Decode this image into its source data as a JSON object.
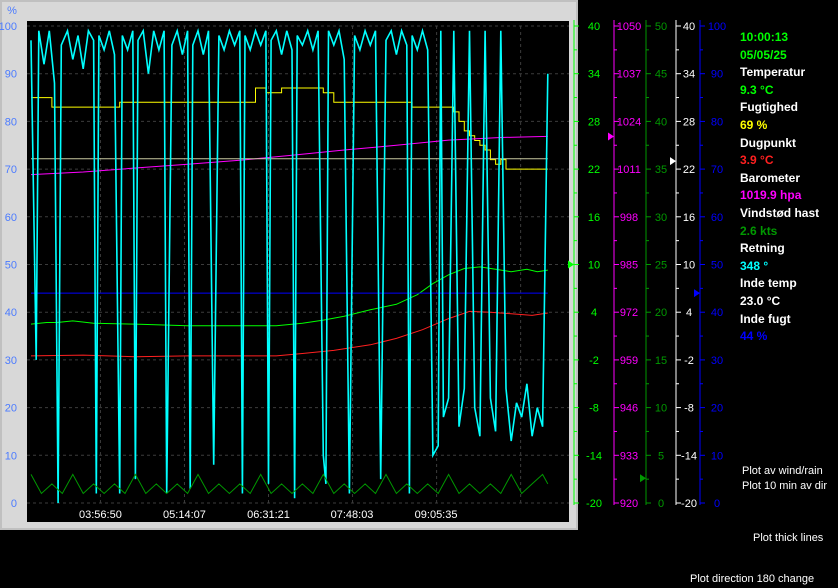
{
  "readout": {
    "time": "10:00:13",
    "date": "05/05/25",
    "items": [
      {
        "label": "Temperatur",
        "value": "9.3 °C",
        "color": "#00ff00"
      },
      {
        "label": "Fugtighed",
        "value": "69 %",
        "color": "#ffff00"
      },
      {
        "label": "Dugpunkt",
        "value": "3.9 °C",
        "color": "#ff2020"
      },
      {
        "label": "Barometer",
        "value": "1019.9 hpa",
        "color": "#ff00ff"
      },
      {
        "label": "Vindstød hast",
        "value": "2.6 kts",
        "color": "#009900"
      },
      {
        "label": "Retning",
        "value": "348 °",
        "color": "#00ffff"
      },
      {
        "label": "Inde temp",
        "value": "23.0 °C",
        "color": "#ffffff"
      },
      {
        "label": "Inde fugt",
        "value": "44 %",
        "color": "#0000ff"
      }
    ]
  },
  "options": {
    "plot_av": "Plot av wind/rain",
    "plot_10min": "Plot 10 min av dir",
    "thick_lines": "Plot thick lines",
    "direction_change": "Plot direction 180 change"
  },
  "chart_data": {
    "type": "line",
    "grid": true,
    "plot_background": "#000000",
    "frame_color": "#c0c0c0",
    "x_tick_labels": [
      "03:56:50",
      "05:14:07",
      "06:31:21",
      "07:48:03",
      "09:05:35"
    ],
    "x_tick_fractions": [
      0.133,
      0.294,
      0.455,
      0.615,
      0.776
    ],
    "y_left_unit": "%",
    "y_left_ticks": [
      "100",
      "90",
      "80",
      "70",
      "60",
      "50",
      "40",
      "30",
      "20",
      "10",
      "0"
    ],
    "y_left_range": [
      0,
      100
    ],
    "right_axes": [
      {
        "name": "Temperatur",
        "color": "#00ff00",
        "range": [
          -20,
          40
        ],
        "ticks": [
          "40",
          "34",
          "28",
          "22",
          "16",
          "10",
          "4",
          "-2",
          "-8",
          "-14",
          "-20"
        ],
        "marker_value": 10
      },
      {
        "name": "Barometer",
        "color": "#ff00ff",
        "range": [
          920,
          1050
        ],
        "ticks": [
          "1050",
          "1037",
          "1024",
          "1011",
          "998",
          "985",
          "972",
          "959",
          "946",
          "933",
          "920"
        ],
        "marker_value": 1019.9
      },
      {
        "name": "Vindstød hast",
        "color": "#009900",
        "range": [
          0,
          50
        ],
        "ticks": [
          "50",
          "45",
          "40",
          "35",
          "30",
          "25",
          "20",
          "15",
          "10",
          "5",
          "0"
        ],
        "marker_value": 2.6
      },
      {
        "name": "Inde temp",
        "color": "#ffffff",
        "range": [
          -20,
          40
        ],
        "ticks": [
          "40",
          "34",
          "28",
          "22",
          "16",
          "10",
          "4",
          "-2",
          "-8",
          "-14",
          "-20"
        ],
        "marker_value": 23.0
      },
      {
        "name": "Inde fugt",
        "color": "#0000ff",
        "range": [
          0,
          100
        ],
        "ticks": [
          "100",
          "90",
          "80",
          "70",
          "60",
          "50",
          "40",
          "30",
          "20",
          "10",
          "0"
        ],
        "marker_value": 44
      }
    ],
    "series": [
      {
        "name": "Fugtighed",
        "color": "#ffff00",
        "axis": "pct",
        "points": [
          [
            0,
            85
          ],
          [
            0.03,
            85
          ],
          [
            0.04,
            83
          ],
          [
            0.11,
            83
          ],
          [
            0.17,
            84
          ],
          [
            0.42,
            84
          ],
          [
            0.43,
            87
          ],
          [
            0.44,
            87
          ],
          [
            0.45,
            86
          ],
          [
            0.47,
            86
          ],
          [
            0.48,
            87
          ],
          [
            0.55,
            87
          ],
          [
            0.56,
            86
          ],
          [
            0.57,
            86
          ],
          [
            0.58,
            84
          ],
          [
            0.72,
            84
          ],
          [
            0.73,
            83
          ],
          [
            0.8,
            83
          ],
          [
            0.81,
            82
          ],
          [
            0.82,
            80
          ],
          [
            0.83,
            78
          ],
          [
            0.84,
            77
          ],
          [
            0.85,
            76
          ],
          [
            0.86,
            75
          ],
          [
            0.87,
            74
          ],
          [
            0.88,
            72
          ],
          [
            0.89,
            71
          ],
          [
            0.9,
            72
          ],
          [
            0.91,
            70
          ],
          [
            0.99,
            70
          ]
        ]
      },
      {
        "name": "Barometer",
        "color": "#ff00ff",
        "axis": "baro",
        "points": [
          [
            0,
            1009.5
          ],
          [
            0.1,
            1010.2
          ],
          [
            0.2,
            1011.3
          ],
          [
            0.3,
            1012.3
          ],
          [
            0.4,
            1013.4
          ],
          [
            0.5,
            1014.8
          ],
          [
            0.6,
            1016.2
          ],
          [
            0.7,
            1017.5
          ],
          [
            0.8,
            1018.9
          ],
          [
            0.9,
            1019.6
          ],
          [
            0.99,
            1019.9
          ]
        ]
      },
      {
        "name": "Inde temp",
        "color": "#c8c8a0",
        "axis": "inde",
        "points": [
          [
            0,
            23.3
          ],
          [
            0.99,
            23.3
          ]
        ]
      },
      {
        "name": "Temperatur",
        "color": "#00ff00",
        "axis": "temp",
        "points": [
          [
            0,
            2.5
          ],
          [
            0.03,
            2.7
          ],
          [
            0.05,
            2.7
          ],
          [
            0.08,
            2.9
          ],
          [
            0.12,
            2.6
          ],
          [
            0.2,
            2.5
          ],
          [
            0.3,
            2.3
          ],
          [
            0.4,
            2.3
          ],
          [
            0.47,
            2.3
          ],
          [
            0.52,
            2.6
          ],
          [
            0.56,
            3.0
          ],
          [
            0.6,
            3.5
          ],
          [
            0.65,
            4.3
          ],
          [
            0.7,
            5.0
          ],
          [
            0.74,
            6.2
          ],
          [
            0.77,
            7.6
          ],
          [
            0.8,
            8.7
          ],
          [
            0.83,
            9.5
          ],
          [
            0.86,
            9.7
          ],
          [
            0.89,
            9.4
          ],
          [
            0.92,
            9.1
          ],
          [
            0.95,
            9.4
          ],
          [
            0.97,
            9.1
          ],
          [
            0.99,
            9.3
          ]
        ]
      },
      {
        "name": "Dugpunkt",
        "color": "#ff2020",
        "axis": "temp",
        "points": [
          [
            0,
            -1.5
          ],
          [
            0.1,
            -1.4
          ],
          [
            0.2,
            -1.6
          ],
          [
            0.3,
            -1.5
          ],
          [
            0.47,
            -1.5
          ],
          [
            0.52,
            -1.2
          ],
          [
            0.58,
            -0.8
          ],
          [
            0.65,
            -0.1
          ],
          [
            0.7,
            0.7
          ],
          [
            0.75,
            1.8
          ],
          [
            0.8,
            3.2
          ],
          [
            0.84,
            4.1
          ],
          [
            0.88,
            4.0
          ],
          [
            0.92,
            3.8
          ],
          [
            0.96,
            3.6
          ],
          [
            0.99,
            3.9
          ]
        ]
      },
      {
        "name": "Inde fugt",
        "color": "#0000ff",
        "axis": "fugt",
        "points": [
          [
            0,
            44
          ],
          [
            0.99,
            44
          ]
        ]
      },
      {
        "name": "Retning",
        "color": "#00ffff",
        "axis": "dir",
        "points": [
          [
            0.0,
            97
          ],
          [
            0.01,
            30
          ],
          [
            0.015,
            99
          ],
          [
            0.025,
            92
          ],
          [
            0.035,
            99
          ],
          [
            0.045,
            88
          ],
          [
            0.052,
            0
          ],
          [
            0.058,
            96
          ],
          [
            0.07,
            99
          ],
          [
            0.08,
            93
          ],
          [
            0.09,
            98
          ],
          [
            0.1,
            91
          ],
          [
            0.11,
            99
          ],
          [
            0.12,
            97
          ],
          [
            0.125,
            2
          ],
          [
            0.13,
            98
          ],
          [
            0.14,
            95
          ],
          [
            0.15,
            99
          ],
          [
            0.16,
            94
          ],
          [
            0.17,
            2
          ],
          [
            0.175,
            98
          ],
          [
            0.185,
            95
          ],
          [
            0.195,
            99
          ],
          [
            0.2,
            5
          ],
          [
            0.205,
            97
          ],
          [
            0.215,
            99
          ],
          [
            0.225,
            90
          ],
          [
            0.235,
            99
          ],
          [
            0.245,
            95
          ],
          [
            0.255,
            99
          ],
          [
            0.26,
            2
          ],
          [
            0.27,
            96
          ],
          [
            0.28,
            99
          ],
          [
            0.29,
            94
          ],
          [
            0.3,
            99
          ],
          [
            0.305,
            3
          ],
          [
            0.31,
            96
          ],
          [
            0.32,
            99
          ],
          [
            0.33,
            94
          ],
          [
            0.34,
            99
          ],
          [
            0.35,
            8
          ],
          [
            0.36,
            98
          ],
          [
            0.37,
            95
          ],
          [
            0.38,
            99
          ],
          [
            0.39,
            96
          ],
          [
            0.4,
            99
          ],
          [
            0.405,
            2
          ],
          [
            0.41,
            98
          ],
          [
            0.42,
            95
          ],
          [
            0.43,
            99
          ],
          [
            0.44,
            96
          ],
          [
            0.45,
            99
          ],
          [
            0.455,
            4
          ],
          [
            0.46,
            97
          ],
          [
            0.47,
            99
          ],
          [
            0.48,
            94
          ],
          [
            0.49,
            99
          ],
          [
            0.5,
            95
          ],
          [
            0.505,
            1
          ],
          [
            0.51,
            98
          ],
          [
            0.52,
            96
          ],
          [
            0.53,
            99
          ],
          [
            0.54,
            95
          ],
          [
            0.55,
            99
          ],
          [
            0.56,
            10
          ],
          [
            0.565,
            4
          ],
          [
            0.57,
            99
          ],
          [
            0.58,
            96
          ],
          [
            0.59,
            99
          ],
          [
            0.6,
            93
          ],
          [
            0.61,
            2
          ],
          [
            0.62,
            98
          ],
          [
            0.63,
            95
          ],
          [
            0.64,
            99
          ],
          [
            0.65,
            96
          ],
          [
            0.66,
            99
          ],
          [
            0.67,
            5
          ],
          [
            0.68,
            97
          ],
          [
            0.69,
            99
          ],
          [
            0.7,
            94
          ],
          [
            0.71,
            99
          ],
          [
            0.72,
            96
          ],
          [
            0.725,
            2
          ],
          [
            0.73,
            98
          ],
          [
            0.74,
            95
          ],
          [
            0.75,
            99
          ],
          [
            0.76,
            95
          ],
          [
            0.77,
            10
          ],
          [
            0.78,
            12
          ],
          [
            0.785,
            99
          ],
          [
            0.79,
            18
          ],
          [
            0.8,
            22
          ],
          [
            0.81,
            99
          ],
          [
            0.82,
            16
          ],
          [
            0.83,
            24
          ],
          [
            0.84,
            99
          ],
          [
            0.85,
            20
          ],
          [
            0.86,
            14
          ],
          [
            0.87,
            99
          ],
          [
            0.88,
            22
          ],
          [
            0.89,
            15
          ],
          [
            0.9,
            99
          ],
          [
            0.91,
            24
          ],
          [
            0.92,
            13
          ],
          [
            0.93,
            21
          ],
          [
            0.94,
            18
          ],
          [
            0.95,
            25
          ],
          [
            0.96,
            14
          ],
          [
            0.97,
            20
          ],
          [
            0.98,
            16
          ],
          [
            0.99,
            90
          ]
        ]
      },
      {
        "name": "Vindstød hast",
        "color": "#009900",
        "axis": "gust",
        "points": [
          [
            0.0,
            3
          ],
          [
            0.02,
            1
          ],
          [
            0.04,
            2
          ],
          [
            0.06,
            1
          ],
          [
            0.08,
            3
          ],
          [
            0.1,
            1
          ],
          [
            0.12,
            2
          ],
          [
            0.14,
            1
          ],
          [
            0.16,
            2
          ],
          [
            0.18,
            1
          ],
          [
            0.2,
            3
          ],
          [
            0.22,
            1
          ],
          [
            0.24,
            2
          ],
          [
            0.26,
            1
          ],
          [
            0.28,
            2
          ],
          [
            0.3,
            1
          ],
          [
            0.32,
            3
          ],
          [
            0.34,
            1
          ],
          [
            0.36,
            2
          ],
          [
            0.38,
            1
          ],
          [
            0.4,
            2
          ],
          [
            0.42,
            1
          ],
          [
            0.44,
            3
          ],
          [
            0.46,
            1
          ],
          [
            0.48,
            2
          ],
          [
            0.5,
            1
          ],
          [
            0.52,
            2
          ],
          [
            0.54,
            1
          ],
          [
            0.56,
            3
          ],
          [
            0.58,
            1
          ],
          [
            0.6,
            2
          ],
          [
            0.62,
            1
          ],
          [
            0.64,
            2
          ],
          [
            0.66,
            1
          ],
          [
            0.68,
            3
          ],
          [
            0.7,
            1
          ],
          [
            0.72,
            2
          ],
          [
            0.74,
            1
          ],
          [
            0.76,
            2
          ],
          [
            0.78,
            1
          ],
          [
            0.8,
            3
          ],
          [
            0.82,
            1
          ],
          [
            0.84,
            2
          ],
          [
            0.86,
            1
          ],
          [
            0.88,
            2
          ],
          [
            0.9,
            1
          ],
          [
            0.92,
            3
          ],
          [
            0.94,
            1
          ],
          [
            0.96,
            2
          ],
          [
            0.98,
            3
          ],
          [
            0.99,
            2
          ]
        ]
      }
    ]
  }
}
